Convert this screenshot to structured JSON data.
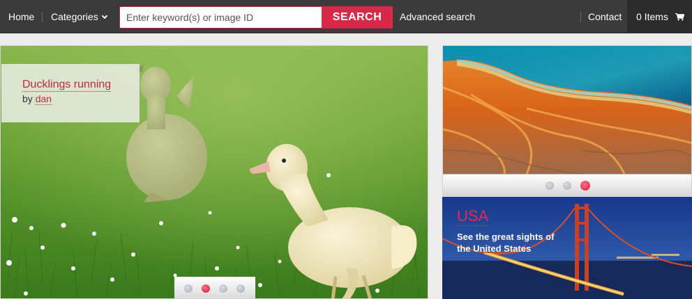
{
  "nav": {
    "home": "Home",
    "categories": "Categories",
    "search_placeholder": "Enter keyword(s) or image ID",
    "search_button": "SEARCH",
    "advanced": "Advanced search",
    "contact": "Contact",
    "cart": "0 Items",
    "cart_icon": "shopping-cart-icon"
  },
  "hero": {
    "title": "Ducklings running",
    "by": "by",
    "author": "dan",
    "slides": 4,
    "active_slide": 2
  },
  "feature_top": {
    "slides": 3,
    "active_slide": 3
  },
  "feature_bottom": {
    "title": "USA",
    "subtitle": "See the great sights of the United States"
  },
  "colors": {
    "nav_bg": "#3b3b3b",
    "accent": "#d82a48",
    "link": "#c8283e"
  }
}
